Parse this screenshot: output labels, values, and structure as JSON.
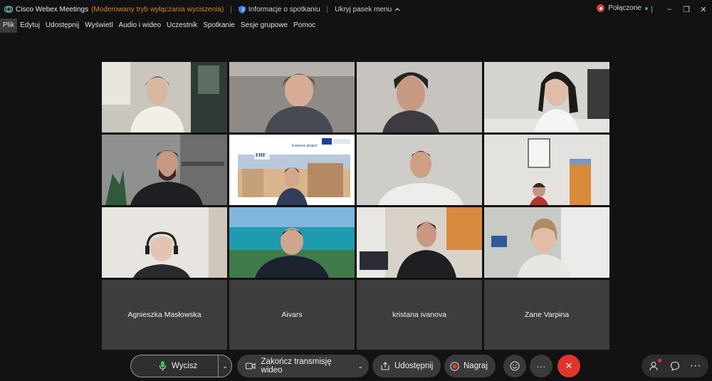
{
  "window": {
    "app_title": "Cisco Webex Meetings",
    "mode": "(Moderowany tryb wyłączania wyciszenia)",
    "meeting_info": "Informacje o spotkaniu",
    "hide_menu": "Ukryj pasek menu",
    "status": "Połączone",
    "minimize": "–",
    "restore": "❐",
    "close": "✕"
  },
  "menu": [
    "Plik",
    "Edytuj",
    "Udostępnij",
    "Wyświetl",
    "Audio i wideo",
    "Uczestnik",
    "Spotkanie",
    "Sesje grupowe",
    "Pomoc"
  ],
  "participants_no_video": [
    "Agnieszka Masłowska",
    "Aivars",
    "kristana ivanova",
    "Zane Varpina"
  ],
  "shared_slide": {
    "logo_text": "FHF",
    "project_text": "Essence project"
  },
  "controls": {
    "mute": "Wycisz",
    "stop_video": "Zakończ transmisję wideo",
    "share": "Udostępnij",
    "record": "Nagraj",
    "more": "···",
    "end": "✕",
    "caret": "⌄"
  },
  "colors": {
    "mute_mode": "#d9822b",
    "end_call": "#e0352b",
    "connected_dot": "#2fb34a",
    "status_badge": "#d4433c"
  }
}
